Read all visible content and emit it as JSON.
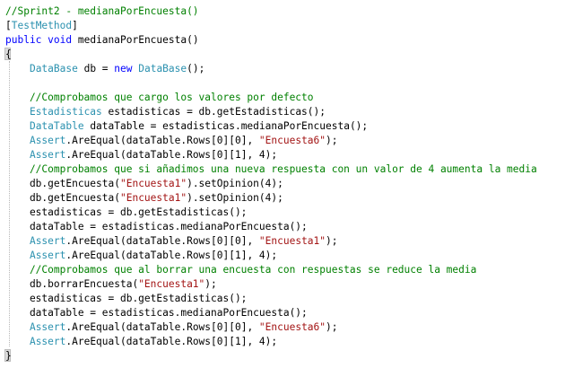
{
  "colors": {
    "comment": "#008000",
    "keyword": "#0000ff",
    "type": "#2b91af",
    "string": "#a31515",
    "text": "#000000"
  },
  "code_lines": [
    [
      {
        "t": "//Sprint2 - medianaPorEncuesta()",
        "c": "comment"
      }
    ],
    [
      {
        "t": "[",
        "c": "text"
      },
      {
        "t": "TestMethod",
        "c": "type"
      },
      {
        "t": "]",
        "c": "text"
      }
    ],
    [
      {
        "t": "public",
        "c": "keyword"
      },
      {
        "t": " ",
        "c": "text"
      },
      {
        "t": "void",
        "c": "keyword"
      },
      {
        "t": " medianaPorEncuesta()",
        "c": "text"
      }
    ],
    [
      {
        "t": "{",
        "c": "text"
      }
    ],
    [
      {
        "t": "    ",
        "c": "text"
      },
      {
        "t": "DataBase",
        "c": "type"
      },
      {
        "t": " db = ",
        "c": "text"
      },
      {
        "t": "new",
        "c": "keyword"
      },
      {
        "t": " ",
        "c": "text"
      },
      {
        "t": "DataBase",
        "c": "type"
      },
      {
        "t": "();",
        "c": "text"
      }
    ],
    [],
    [
      {
        "t": "    //Comprobamos que cargo los valores por defecto",
        "c": "comment"
      }
    ],
    [
      {
        "t": "    ",
        "c": "text"
      },
      {
        "t": "Estadisticas",
        "c": "type"
      },
      {
        "t": " estadisticas = db.getEstadisticas();",
        "c": "text"
      }
    ],
    [
      {
        "t": "    ",
        "c": "text"
      },
      {
        "t": "DataTable",
        "c": "type"
      },
      {
        "t": " dataTable = estadisticas.medianaPorEncuesta();",
        "c": "text"
      }
    ],
    [
      {
        "t": "    ",
        "c": "text"
      },
      {
        "t": "Assert",
        "c": "type"
      },
      {
        "t": ".AreEqual(dataTable.Rows[0][0], ",
        "c": "text"
      },
      {
        "t": "\"Encuesta6\"",
        "c": "string"
      },
      {
        "t": ");",
        "c": "text"
      }
    ],
    [
      {
        "t": "    ",
        "c": "text"
      },
      {
        "t": "Assert",
        "c": "type"
      },
      {
        "t": ".AreEqual(dataTable.Rows[0][1], 4);",
        "c": "text"
      }
    ],
    [
      {
        "t": "    //Comprobamos que si añadimos una nueva respuesta con un valor de 4 aumenta la media",
        "c": "comment"
      }
    ],
    [
      {
        "t": "    db.getEncuesta(",
        "c": "text"
      },
      {
        "t": "\"Encuesta1\"",
        "c": "string"
      },
      {
        "t": ").setOpinion(4);",
        "c": "text"
      }
    ],
    [
      {
        "t": "    db.getEncuesta(",
        "c": "text"
      },
      {
        "t": "\"Encuesta1\"",
        "c": "string"
      },
      {
        "t": ").setOpinion(4);",
        "c": "text"
      }
    ],
    [
      {
        "t": "    estadisticas = db.getEstadisticas();",
        "c": "text"
      }
    ],
    [
      {
        "t": "    dataTable = estadisticas.medianaPorEncuesta();",
        "c": "text"
      }
    ],
    [
      {
        "t": "    ",
        "c": "text"
      },
      {
        "t": "Assert",
        "c": "type"
      },
      {
        "t": ".AreEqual(dataTable.Rows[0][0], ",
        "c": "text"
      },
      {
        "t": "\"Encuesta1\"",
        "c": "string"
      },
      {
        "t": ");",
        "c": "text"
      }
    ],
    [
      {
        "t": "    ",
        "c": "text"
      },
      {
        "t": "Assert",
        "c": "type"
      },
      {
        "t": ".AreEqual(dataTable.Rows[0][1], 4);",
        "c": "text"
      }
    ],
    [
      {
        "t": "    //Comprobamos que al borrar una encuesta con respuestas se reduce la media",
        "c": "comment"
      }
    ],
    [
      {
        "t": "    db.borrarEncuesta(",
        "c": "text"
      },
      {
        "t": "\"Encuesta1\"",
        "c": "string"
      },
      {
        "t": ");",
        "c": "text"
      }
    ],
    [
      {
        "t": "    estadisticas = db.getEstadisticas();",
        "c": "text"
      }
    ],
    [
      {
        "t": "    dataTable = estadisticas.medianaPorEncuesta();",
        "c": "text"
      }
    ],
    [
      {
        "t": "    ",
        "c": "text"
      },
      {
        "t": "Assert",
        "c": "type"
      },
      {
        "t": ".AreEqual(dataTable.Rows[0][0], ",
        "c": "text"
      },
      {
        "t": "\"Encuesta6\"",
        "c": "string"
      },
      {
        "t": ");",
        "c": "text"
      }
    ],
    [
      {
        "t": "    ",
        "c": "text"
      },
      {
        "t": "Assert",
        "c": "type"
      },
      {
        "t": ".AreEqual(dataTable.Rows[0][1], 4);",
        "c": "text"
      }
    ],
    [
      {
        "t": "}",
        "c": "text"
      }
    ]
  ]
}
